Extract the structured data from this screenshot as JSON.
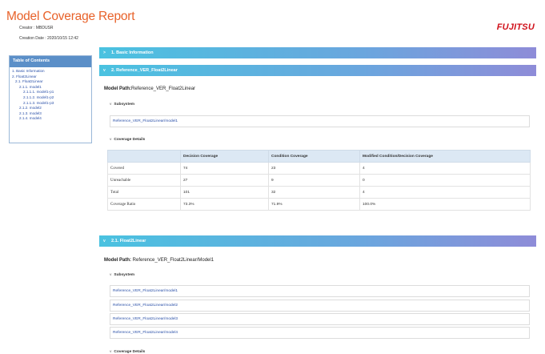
{
  "header": {
    "title": "Model Coverage Report",
    "creator": "Creator : MBDUSR",
    "creation_date": "Creation Date : 2020/10/15 12:42",
    "logo": "FUJITSU"
  },
  "toc": {
    "title": "Table of Contents",
    "items": [
      "1. Basic Information",
      "2. Float2Linear",
      "2.1. Float2Linear",
      "2.1.1. model1",
      "2.1.1.1. model1-p1",
      "2.1.1.2. model1-p2",
      "2.1.1.3. model1-p3",
      "2.1.2. model2",
      "2.1.3. model3",
      "2.1.4. model4"
    ]
  },
  "sections": {
    "basic": {
      "chevron": ">",
      "label": "1. Basic Information"
    },
    "ref": {
      "chevron": "v",
      "label": "2. Reference_VER_Float2Linear"
    },
    "float": {
      "chevron": "v",
      "label": "2.1. Float2Linear"
    }
  },
  "ref_section": {
    "model_path_label": "Model Path:",
    "model_path_value": "Reference_VER_Float2Linear",
    "subsystem_label": "Subsystem",
    "subsystem_link": "Reference_VER_Float2Linear/model1",
    "coverage_label": "Coverage Details",
    "table": {
      "headers": [
        "",
        "Decision Coverage",
        "Condition Coverage",
        "Modified Condition/Decision Coverage"
      ],
      "rows": [
        [
          "Covered",
          "74",
          "23",
          "4"
        ],
        [
          "Unreachable",
          "27",
          "9",
          "0"
        ],
        [
          "Total",
          "101",
          "32",
          "4"
        ],
        [
          "Coverage Ratio",
          "73.3%",
          "71.9%",
          "100.0%"
        ]
      ]
    }
  },
  "float_section": {
    "model_path_label": "Model Path:",
    "model_path_value": "Reference_VER_Float2Linear/Model1",
    "subsystem_label": "Subsystem",
    "links": [
      "Reference_VER_Float2Linear/model1",
      "Reference_VER_Float2Linear/model2",
      "Reference_VER_Float2Linear/model3",
      "Reference_VER_Float2Linear/model4"
    ],
    "coverage_label": "Coverage Details"
  },
  "chevrons": {
    "down": "v"
  }
}
